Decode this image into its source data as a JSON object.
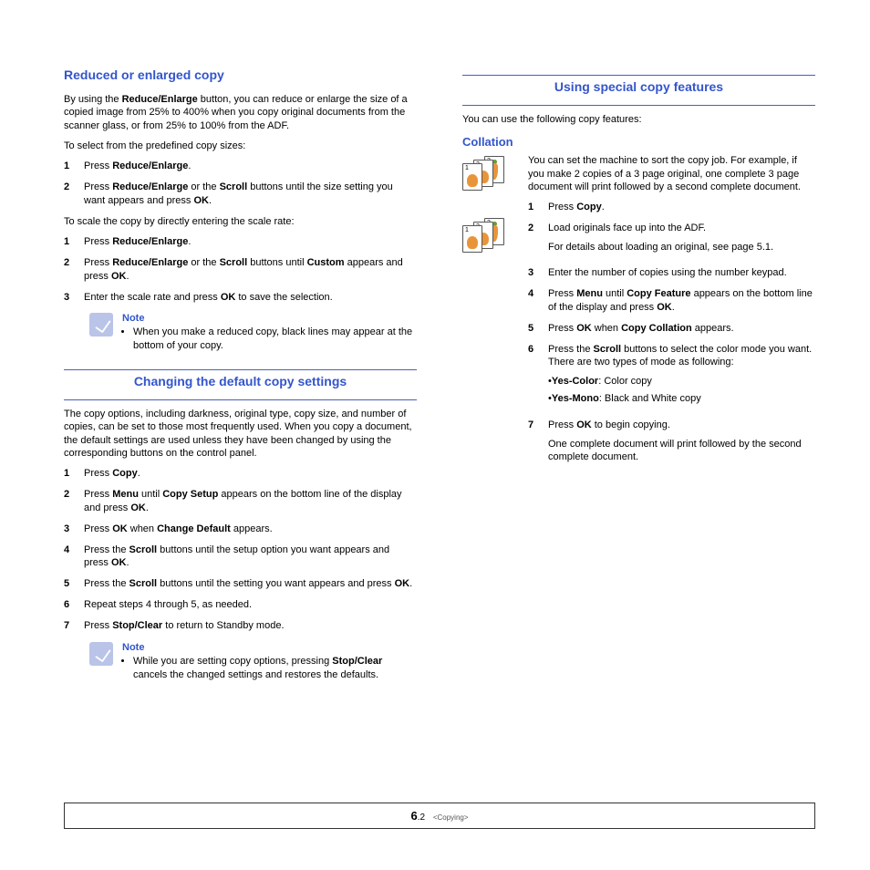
{
  "left": {
    "h1": "Reduced or enlarged copy",
    "intro_parts": [
      "By using the ",
      "Reduce/Enlarge",
      " button, you can reduce or enlarge the size of a copied image from 25% to 400% when you copy original documents from the scanner glass, or from 25% to 100% from the ADF."
    ],
    "p_select": "To select from the predefined copy sizes:",
    "steps_a": [
      {
        "n": "1",
        "parts": [
          "Press ",
          "Reduce/Enlarge",
          "."
        ]
      },
      {
        "n": "2",
        "parts": [
          "Press ",
          "Reduce/Enlarge",
          " or the ",
          "Scroll",
          " buttons until the size setting you want appears and press ",
          "OK",
          "."
        ]
      }
    ],
    "p_scale": "To scale the copy by directly entering the scale rate:",
    "steps_b": [
      {
        "n": "1",
        "parts": [
          "Press ",
          "Reduce/Enlarge",
          "."
        ]
      },
      {
        "n": "2",
        "parts": [
          "Press ",
          "Reduce/Enlarge",
          " or the ",
          "Scroll",
          " buttons until ",
          "Custom",
          " appears and press ",
          "OK",
          "."
        ]
      },
      {
        "n": "3",
        "parts": [
          "Enter the scale rate and press ",
          "OK",
          " to save the selection."
        ]
      }
    ],
    "note1_title": "Note",
    "note1_text": "When you make a reduced copy, black lines may appear at the bottom of your copy.",
    "h2": "Changing the default copy settings",
    "p_default": "The copy options, including darkness, original type, copy size, and number of copies, can be set to those most frequently used. When you copy a document, the default settings are used unless they have been changed by using the corresponding buttons on the control panel.",
    "steps_c": [
      {
        "n": "1",
        "parts": [
          "Press ",
          "Copy",
          "."
        ]
      },
      {
        "n": "2",
        "parts": [
          "Press ",
          "Menu",
          " until ",
          "Copy Setup",
          " appears on the bottom line of the display and press ",
          "OK",
          "."
        ]
      },
      {
        "n": "3",
        "parts": [
          "Press ",
          "OK",
          " when ",
          "Change Default",
          " appears."
        ]
      },
      {
        "n": "4",
        "parts": [
          "Press the ",
          "Scroll",
          " buttons until the setup option you want appears and press ",
          "OK",
          "."
        ]
      },
      {
        "n": "5",
        "parts": [
          "Press the ",
          "Scroll",
          " buttons until the setting you want appears and press ",
          "OK",
          "."
        ]
      },
      {
        "n": "6",
        "parts": [
          "Repeat steps 4 through 5, as needed."
        ]
      },
      {
        "n": "7",
        "parts": [
          "Press ",
          "Stop/Clear",
          " to return to Standby mode."
        ]
      }
    ],
    "note2_title": "Note",
    "note2_parts": [
      "While you are setting copy options, pressing ",
      "Stop/Clear",
      " cancels the changed settings and restores the defaults."
    ]
  },
  "right": {
    "h1": "Using special copy features",
    "intro": "You can use the following copy features:",
    "h2": "Collation",
    "desc": "You can set the machine to sort the copy job. For example, if you make 2 copies of a 3 page original, one complete 3 page document will print followed by a second complete document.",
    "steps": [
      {
        "n": "1",
        "parts": [
          "Press ",
          "Copy",
          "."
        ]
      },
      {
        "n": "2",
        "parts": [
          "Load originals face up into the ADF."
        ],
        "extra": "For details about loading an original, see page 5.1."
      },
      {
        "n": "3",
        "parts": [
          "Enter the number of copies using the number keypad."
        ]
      },
      {
        "n": "4",
        "parts": [
          "Press ",
          "Menu",
          " until ",
          "Copy Feature",
          " appears on the bottom line of the display and press ",
          "OK",
          "."
        ]
      },
      {
        "n": "5",
        "parts": [
          "Press ",
          "OK",
          " when ",
          "Copy Collation",
          " appears."
        ]
      },
      {
        "n": "6",
        "parts": [
          "Press the ",
          "Scroll",
          " buttons to select the color mode you want."
        ],
        "tail": "There are two types of mode as following:",
        "bullets": [
          {
            "b": "Yes-Color",
            "t": ": Color copy"
          },
          {
            "b": "Yes-Mono",
            "t": ": Black and White copy"
          }
        ]
      },
      {
        "n": "7",
        "parts": [
          "Press ",
          "OK",
          " to begin copying."
        ],
        "extra": "One complete document will print followed by the second complete document."
      }
    ]
  },
  "footer": {
    "chapter": "6",
    "page": ".2",
    "label": "<Copying>"
  }
}
